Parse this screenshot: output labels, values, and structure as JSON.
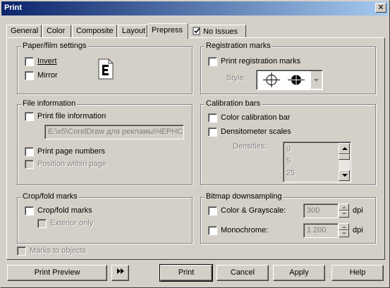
{
  "window": {
    "title": "Print",
    "close_label": "✕"
  },
  "tabs": [
    {
      "label": "General"
    },
    {
      "label": "Color"
    },
    {
      "label": "Composite"
    },
    {
      "label": "Layout"
    },
    {
      "label": "Prepress"
    },
    {
      "label": "No Issues"
    }
  ],
  "active_tab": "Prepress",
  "paper_film": {
    "legend": "Paper/film settings",
    "invert": "Invert",
    "mirror": "Mirror"
  },
  "file_info": {
    "legend": "File information",
    "print_file_info": "Print file information",
    "path_value": "E:\\x5\\CorelDraw для рекламы\\ЧЕРНС",
    "print_page_numbers": "Print page numbers",
    "position_within_page": "Position within page"
  },
  "crop_fold": {
    "legend": "Crop/fold marks",
    "crop_fold_marks": "Crop/fold marks",
    "exterior_only": "Exterior only"
  },
  "marks_to_objects": "Marks to objects",
  "registration": {
    "legend": "Registration marks",
    "print_registration": "Print registration marks",
    "style_label": "Style:"
  },
  "calibration": {
    "legend": "Calibration bars",
    "color_calibration": "Color calibration bar",
    "densitometer": "Densitometer scales",
    "densities_label": "Densities:",
    "densities": [
      "0",
      "5",
      "25"
    ]
  },
  "bitmap": {
    "legend": "Bitmap downsampling",
    "color_grayscale": "Color & Grayscale:",
    "color_value": "300",
    "color_unit": "dpi",
    "monochrome": "Monochrome:",
    "mono_value": "1 200",
    "mono_unit": "dpi"
  },
  "buttons": {
    "print_preview": "Print Preview",
    "print": "Print",
    "cancel": "Cancel",
    "apply": "Apply",
    "help": "Help"
  }
}
